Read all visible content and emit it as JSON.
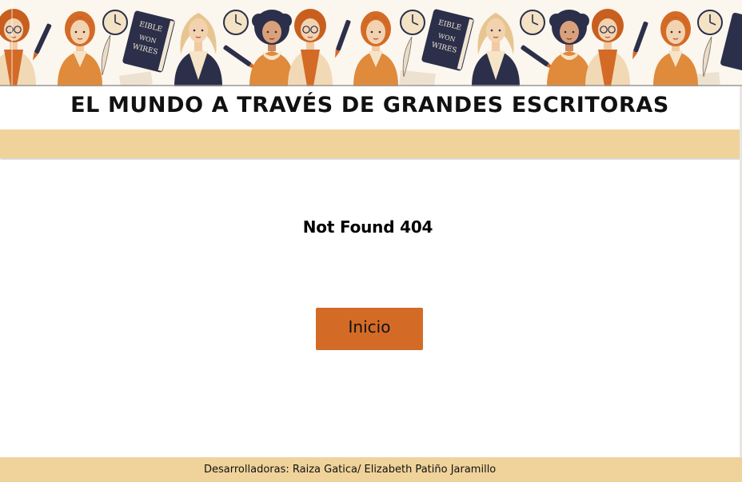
{
  "header": {
    "banner_book_text": [
      "EIBLE",
      "WON",
      "WIRES"
    ],
    "title": "EL MUNDO A TRAVÉS DE GRANDES ESCRITORAS"
  },
  "main": {
    "error_message": "Not Found 404",
    "home_button_label": "Inicio"
  },
  "footer": {
    "credits": "Desarrolladoras: Raiza Gatica/ Elizabeth Patiño Jaramillo"
  },
  "colors": {
    "accent": "#d36b27",
    "bar": "#f0d39b",
    "ink": "#2b2f4a"
  },
  "icons": [
    "woman-portrait-icon",
    "clock-icon",
    "book-icon",
    "quill-pen-icon",
    "fountain-pen-icon"
  ]
}
